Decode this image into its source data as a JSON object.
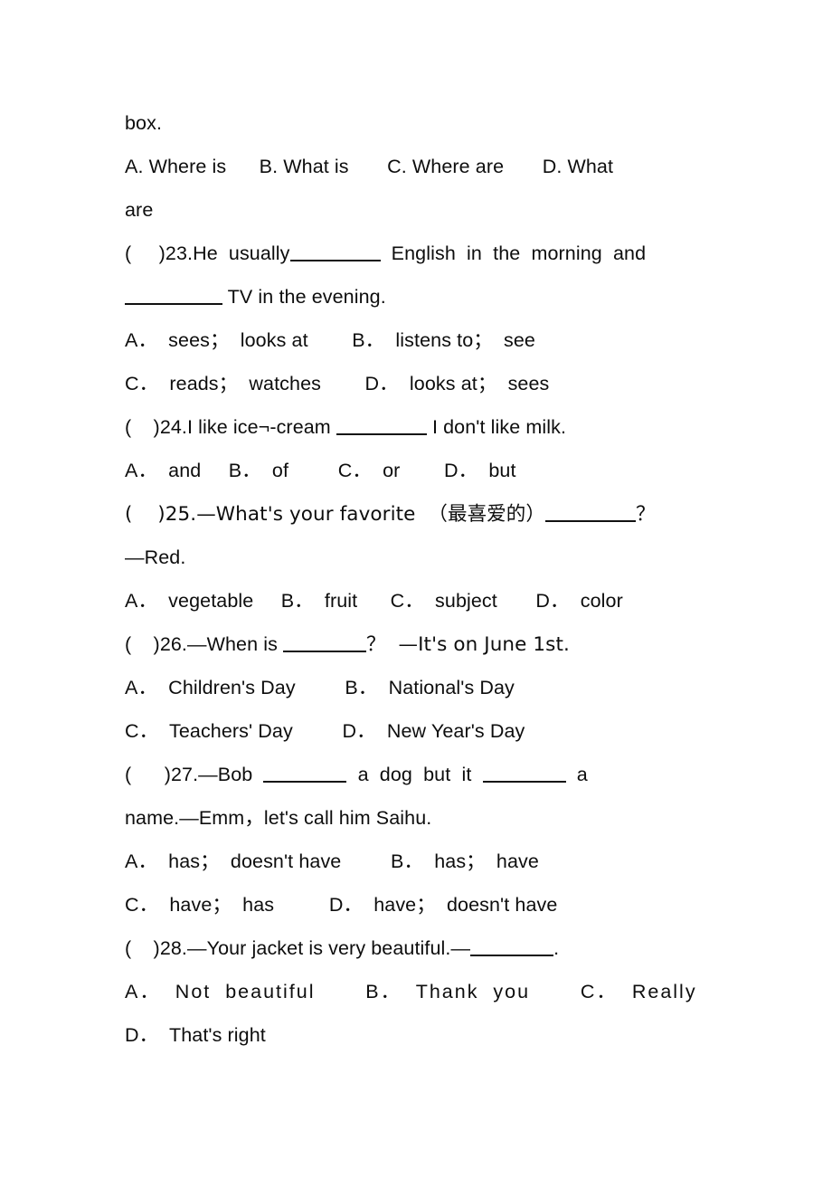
{
  "document": {
    "kind": "english-exam-worksheet",
    "page_background": "#ffffff",
    "text_color": "#0d0d0d",
    "lines": {
      "q22_continuation": "box.",
      "q22_options": "A. Where is      B. What is       C. Where are       D. What",
      "q22_options_wrap": "are",
      "q23_stem_a": "(     )23.He  usually",
      "q23_stem_b": "  English  in  the  morning  and",
      "q23_stem_c": " TV in the evening.",
      "q23_opt_ab": "A．  sees；  looks at        B．  listens to；  see",
      "q23_opt_cd": "C．  reads；  watches        D．  looks at；  sees",
      "q24_stem_a": "(    )24.I like ice¬-cream ",
      "q24_stem_b": " I don't like milk.",
      "q24_opts": "A．  and     B．  of         C．  or        D．  but",
      "q25_stem_a": "(    )25.—What's your favorite  （最喜爱的）",
      "q25_stem_b": "？",
      "q25_stem_wrap": "—Red.",
      "q25_opts": "A．  vegetable     B．  fruit      C．  subject       D．  color",
      "q26_stem_a": "(    )26.—When is ",
      "q26_stem_b": "？  —It's on June 1st.",
      "q26_opt_ab": "A．  Children's Day         B．  National's Day",
      "q26_opt_cd": "C．  Teachers' Day         D．  New Year's Day",
      "q27_stem_a": "(      )27.—Bob  ",
      "q27_stem_b": "  a  dog  but  it  ",
      "q27_stem_c": "  a",
      "q27_stem_wrap": "name.—Emm，let's call him Saihu.",
      "q27_opt_ab": "A．  has；  doesn't have         B．  has；  have",
      "q27_opt_cd": "C．  have；  has          D．  have；  doesn't have",
      "q28_stem_a": "(    )28.—Your jacket is very beautiful.—",
      "q28_stem_b": ".",
      "q28_opt_abc": "A．  Not  beautiful       B．  Thank  you       C．  Really",
      "q28_opt_d": "D．  That's right"
    }
  }
}
